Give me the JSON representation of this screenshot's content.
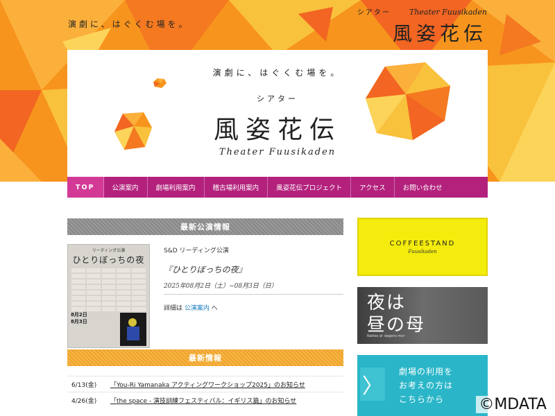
{
  "header": {
    "tagline": "演劇に、はぐくむ場を。",
    "logo_kana": "シアター",
    "logo_en": "Theater Fuusikaden",
    "logo_jp": "風姿花伝"
  },
  "hero": {
    "tagline": "演劇に、はぐくむ場を。",
    "kana": "シアター",
    "title_jp": "風姿花伝",
    "title_en": "Theater Fuusikaden"
  },
  "nav": {
    "items": [
      {
        "label": "TOP"
      },
      {
        "label": "公演案内"
      },
      {
        "label": "劇場利用案内"
      },
      {
        "label": "稽古場利用案内"
      },
      {
        "label": "風姿花伝プロジェクト"
      },
      {
        "label": "アクセス"
      },
      {
        "label": "お問い合わせ"
      }
    ]
  },
  "latest_performance": {
    "section_title": "最新公演情報",
    "poster_subtitle": "リーディング公演",
    "poster_title": "ひとりぼっちの夜",
    "poster_date1": "8月2日",
    "poster_date2": "8月3日",
    "organizer": "S&D リーディング公演",
    "title": "『ひとりぼっちの夜』",
    "date": "2025年08月2日（土）~08月3日（日）",
    "detail_prefix": "詳細は",
    "detail_link": "公演案内",
    "detail_suffix": "へ"
  },
  "news": {
    "section_title": "最新情報",
    "items": [
      {
        "date": "6/13(金)",
        "text": "「You-Ri Yamanaka アクティングワークショップ2025」のお知らせ"
      },
      {
        "date": "4/26(金)",
        "text": "「the space - 演技訓練フェスティバル：イギリス篇」のお知らせ"
      }
    ]
  },
  "sidebar": {
    "coffee_title": "COFFEESTAND",
    "coffee_sub": "Fuusikaden",
    "night_line1": "夜は",
    "night_line2": "昼の母",
    "night_caption": "Nattes är dagens mor",
    "use_line1": "劇場の利用を",
    "use_line2": "お考えの方は",
    "use_line3": "こちらから",
    "use_arrow": "〉"
  },
  "watermark": "©MDATA",
  "colors": {
    "nav_bg": "#b3217d",
    "nav_top": "#d23a96",
    "orange": "#f39a10",
    "yellow_bar": "#f4ec0c",
    "teal": "#2ab6c8"
  }
}
